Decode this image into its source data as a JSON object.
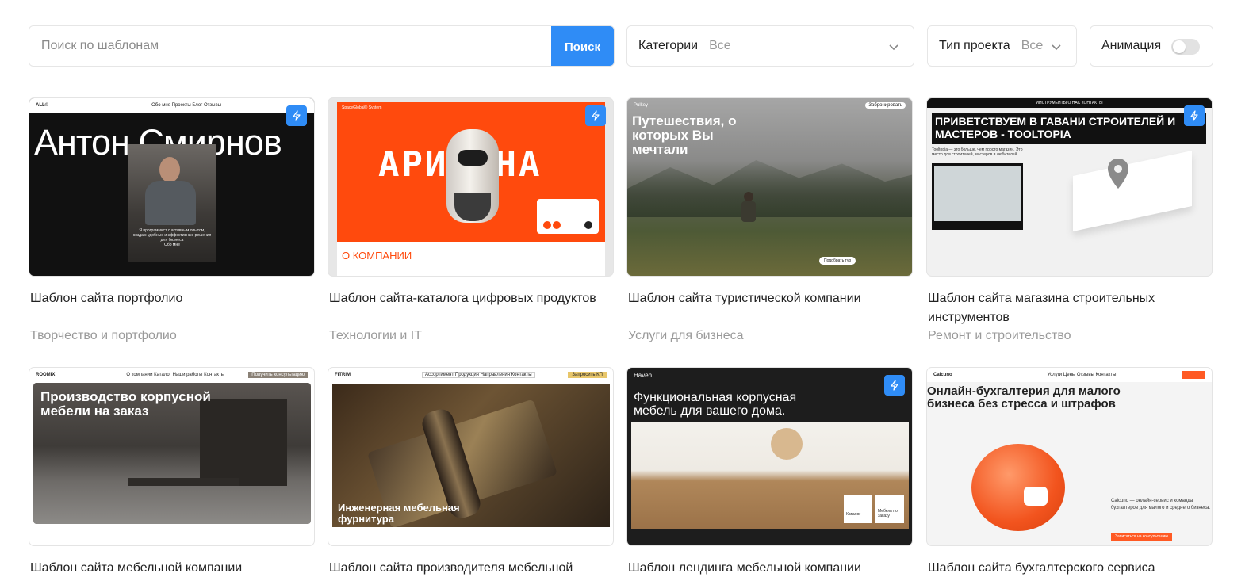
{
  "search": {
    "placeholder": "Поиск по шаблонам",
    "button": "Поиск"
  },
  "filters": {
    "categories": {
      "label": "Категории",
      "value": "Все"
    },
    "project_type": {
      "label": "Тип проекта",
      "value": "Все"
    },
    "animation": {
      "label": "Анимация",
      "enabled": false
    }
  },
  "colors": {
    "accent": "#2f8cf6",
    "muted": "#9a9a9a"
  },
  "cards": [
    {
      "title": "Шаблон сайта портфолио",
      "category": "Творчество и портфолио",
      "animated": true,
      "preview": {
        "logo": "ALL©",
        "nav": "Обо мне  Проекты  Блог  Отзывы",
        "headline": "Антон Смирнов",
        "text": "Я программист с активным опытом, создаю удобные и эффективные решения для бизнеса",
        "button": "Обо мне"
      }
    },
    {
      "title": "Шаблон сайта-каталога цифровых продуктов",
      "category": "Технологии и IT",
      "animated": true,
      "preview": {
        "logo": "SpaceGlobal® System",
        "headline": "АРИАДНА",
        "section": "О КОМПАНИИ"
      }
    },
    {
      "title": "Шаблон сайта туристической компании",
      "category": "Услуги для бизнеса",
      "animated": false,
      "preview": {
        "logo": "Pulkey",
        "button": "Забронировать",
        "headline": "Путешествия, о которых Вы мечтали",
        "cta": "Подобрать тур"
      }
    },
    {
      "title": "Шаблон сайта магазина строительных инструментов",
      "category": "Ремонт и строительство",
      "animated": true,
      "preview": {
        "headline": "ПРИВЕТСТВУЕМ В ГАВАНИ СТРОИТЕЛЕЙ И МАСТЕРОВ - TOOLTOPIA",
        "text": "Tooltopia — это больше, чем просто магазин. Это место для строителей, мастеров и любителей.",
        "nav": "ИНСТРУМЕНТЫ  О НАС  КОНТАКТЫ"
      }
    },
    {
      "title": "Шаблон сайта мебельной компании",
      "category": "",
      "animated": false,
      "preview": {
        "logo": "ROOMIX",
        "nav": "О компании  Каталог  Наши работы  Контакты",
        "button": "Получить консультацию",
        "headline": "Производство корпусной мебели на заказ"
      }
    },
    {
      "title": "Шаблон сайта производителя мебельной",
      "category": "",
      "animated": false,
      "preview": {
        "logo": "FITRIM",
        "nav": "Ассортимент  Продукция  Направления  Контакты",
        "button": "Запросить КП",
        "headline": "Инженерная мебельная фурнитура"
      }
    },
    {
      "title": "Шаблон лендинга мебельной компании",
      "category": "",
      "animated": true,
      "preview": {
        "logo": "Haven",
        "headline": "Функциональная корпусная мебель для вашего дома.",
        "tile1": "Каталог",
        "tile2": "Мебель по заказу"
      }
    },
    {
      "title": "Шаблон сайта бухгалтерского сервиса",
      "category": "",
      "animated": false,
      "preview": {
        "logo": "Calcuno",
        "nav": "Услуги  Цены  Отзывы  Контакты",
        "headline": "Онлайн-бухгалтерия для малого бизнеса без стресса и штрафов",
        "text": "Calcuno — онлайн-сервис и команда бухгалтеров для малого и среднего бизнеса.",
        "button": "Записаться на консультацию"
      }
    }
  ]
}
